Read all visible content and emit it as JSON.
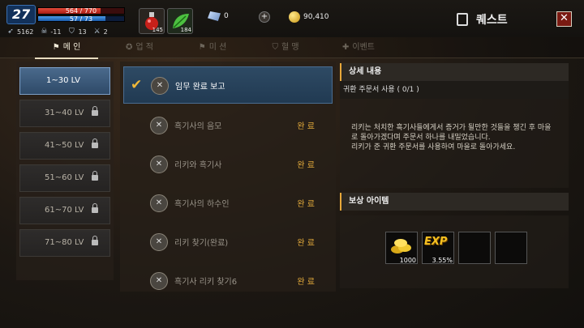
{
  "player": {
    "level": "27",
    "hp": "564 / 770",
    "hp_fill": 0.73,
    "mp": "57 / 73",
    "mp_fill": 0.78,
    "stats": [
      {
        "icon": "wing-icon",
        "value": "5162"
      },
      {
        "icon": "skull-icon",
        "value": "-11"
      },
      {
        "icon": "shield-icon",
        "value": "13"
      },
      {
        "icon": "sword-icon",
        "value": "2"
      }
    ]
  },
  "items": [
    {
      "icon": "red-potion-icon",
      "count": "145"
    },
    {
      "icon": "green-leaf-icon",
      "count": "184"
    }
  ],
  "currency": {
    "gems": "0",
    "plus": "+",
    "gold": "90,410"
  },
  "header": {
    "title": "퀘스트",
    "close": "✕"
  },
  "tabs": [
    {
      "label": "메 인",
      "icon": "flag-icon"
    },
    {
      "label": "업 적",
      "icon": "achievement-icon"
    },
    {
      "label": "미 션",
      "icon": "mission-icon"
    },
    {
      "label": "혈 맹",
      "icon": "clan-icon"
    },
    {
      "label": "이벤트",
      "icon": "gift-icon"
    }
  ],
  "levels": [
    {
      "label": "1~30 LV",
      "locked": false
    },
    {
      "label": "31~40 LV",
      "locked": true
    },
    {
      "label": "41~50 LV",
      "locked": true
    },
    {
      "label": "51~60 LV",
      "locked": true
    },
    {
      "label": "61~70 LV",
      "locked": true
    },
    {
      "label": "71~80 LV",
      "locked": true
    }
  ],
  "quests": [
    {
      "title": "임무 완료 보고",
      "status": "",
      "checked": true
    },
    {
      "title": "흑기사의 음모",
      "status": "완 료"
    },
    {
      "title": "리키와 흑기사",
      "status": "완 료"
    },
    {
      "title": "흑기사의 하수인",
      "status": "완 료"
    },
    {
      "title": "리키 찾기(완료)",
      "status": "완 료"
    },
    {
      "title": "흑기사 리키 찾기6",
      "status": "완 료"
    }
  ],
  "detail": {
    "header": "상세 내용",
    "subtitle": "귀환 주문서 사용 ( 0/1 )",
    "body": "리키는 처치한 흑기사들에게서 증거가 될만한 것들을 챙긴 후 마을로 돌아가겠다며 주문서 하나를 내밀었습니다.\n리키가 준 귀환 주문서를 사용하여 마을로 돌아가세요."
  },
  "rewards": {
    "header": "보상 아이템",
    "items": [
      {
        "icon": "gold-coins-icon",
        "count": "1000"
      },
      {
        "icon": "exp-icon",
        "label": "EXP",
        "count": "3.55%"
      },
      {
        "icon": "empty-slot",
        "count": ""
      },
      {
        "icon": "empty-slot",
        "count": ""
      }
    ]
  }
}
